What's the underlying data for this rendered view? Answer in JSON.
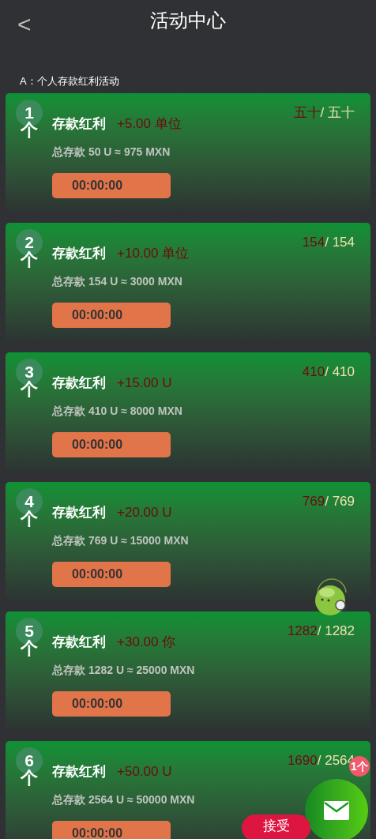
{
  "header": {
    "back": "<",
    "title": "活动中心"
  },
  "section_title": "A：个人存款红利活动",
  "cards": [
    {
      "index": "1",
      "unit": "个",
      "title": "存款红利",
      "bonus": "+5.00 单位",
      "done": "五十",
      "total": "/ 五十",
      "deposit": "总存款 50 U ≈ 975 MXN",
      "timer": "00:00:00"
    },
    {
      "index": "2",
      "unit": "个",
      "title": "存款红利",
      "bonus": "+10.00 单位",
      "done": "154",
      "total": "/ 154",
      "deposit": "总存款 154 U ≈ 3000 MXN",
      "timer": "00:00:00"
    },
    {
      "index": "3",
      "unit": "个",
      "title": "存款红利",
      "bonus": "+15.00 U",
      "done": "410",
      "total": "/ 410",
      "deposit": "总存款 410 U ≈ 8000 MXN",
      "timer": "00:00:00"
    },
    {
      "index": "4",
      "unit": "个",
      "title": "存款红利",
      "bonus": "+20.00 U",
      "done": "769",
      "total": "/ 769",
      "deposit": "总存款 769 U ≈ 15000 MXN",
      "timer": "00:00:00"
    },
    {
      "index": "5",
      "unit": "个",
      "title": "存款红利",
      "bonus": "+30.00 你",
      "done": "1282",
      "total": "/ 1282",
      "deposit": "总存款 1282 U ≈ 25000 MXN",
      "timer": "00:00:00"
    },
    {
      "index": "6",
      "unit": "个",
      "title": "存款红利",
      "bonus": "+50.00 U",
      "done": "1690",
      "total": "/ 2564",
      "deposit": "总存款 2564 U ≈ 50000 MXN",
      "timer": "00:00:00"
    }
  ],
  "mail_badge": "1个",
  "accept_button": "接受"
}
